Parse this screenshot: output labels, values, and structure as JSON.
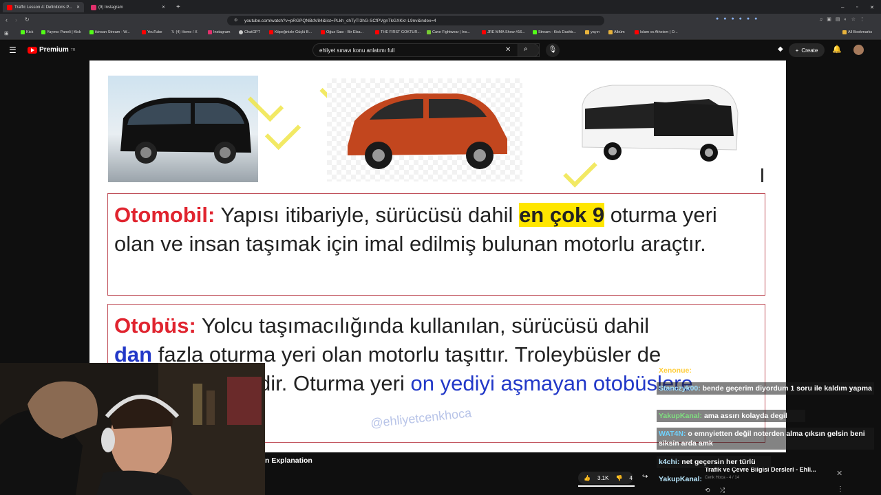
{
  "tabs": [
    {
      "title": "Traffic Lesson 4: Definitions P...",
      "color": "#ff0000",
      "active": true
    },
    {
      "title": "(9) Instagram",
      "color": "#e1306c",
      "active": false
    }
  ],
  "address": "youtube.com/watch?v=pRGPQNBdV84&list=PLkh_chTyTI3hG-SCfPVgnTkGXKkr-L9nv&index=4",
  "bookmarks": [
    "Kick",
    "Yayıncı Paneli | Kick",
    "ikinsan Stream - W...",
    "YouTube",
    "(4) Home / X",
    "Instagram",
    "ChatGPT",
    "Köpeğinizle Güçlü B...",
    "Oğuz Sası - Bir Elsa...",
    "THE FIRST GOKTUR...",
    "Cave Fightwear | Ins...",
    "JRE MMA Show #16...",
    "Stream - Kick Dashb...",
    "yayın",
    "Albüm",
    "Islam vs Atheism | O...",
    "All Bookmarks"
  ],
  "youtube": {
    "logo": "Premium",
    "logo_badge": "TR",
    "search_value": "ehliyet sınavı konu anlatımı full",
    "create_label": "Create"
  },
  "video": {
    "def1": {
      "term": "Otomobil:",
      "text_a": " Yapısı itibariyle, sürücüsü dahil ",
      "highlight": "en çok 9",
      "text_b": " oturma yeri olan ve insan taşımak için imal edilmiş bulunan motorlu araçtır."
    },
    "def2": {
      "term": "Otobüs:",
      "text_a": " Yolcu taşımacılığında kullanılan, sürücüsü dahil ",
      "blue_a": "dan",
      "text_b": " fazla oturma yeri olan motorlu taşıttır. Troleybüsler de",
      "text_c": "dir. Oturma yeri ",
      "blue_b": "on yediyi aşmayan otobüslere"
    },
    "watermark": "@ehliyetcenkhoca"
  },
  "video_title_partial": "n Explanation",
  "like_count": "3.1K",
  "comment_count": "4",
  "playlist_title": "Trafik ve Çevre Bilgisi Dersleri - Ehli...",
  "playlist_sub": "Cenk Hoca - 4 / 14",
  "chat": [
    {
      "user": "Xenonue:",
      "text": ""
    },
    {
      "user": "Stanczyk00:",
      "text": "bende geçerim diyordum 1 soru ile kaldım yapma"
    },
    {
      "user": "YakupKanal:",
      "text": "ama assırı kolayda degil"
    },
    {
      "user": "WAT4N:",
      "text": "o emnyietten değil noterden alma çıksın gelsin beni siksin arda amk"
    },
    {
      "user": "k4chi:",
      "text": "net geçersin her türlü"
    },
    {
      "user": "YakupKanal:",
      "text": ""
    }
  ]
}
